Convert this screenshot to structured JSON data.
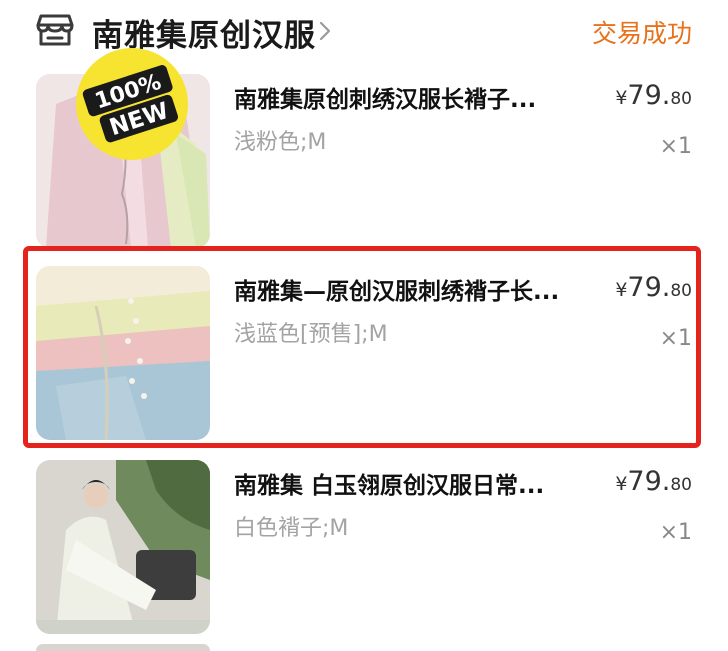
{
  "shop": {
    "name": "南雅集原创汉服",
    "status": "交易成功",
    "status_color": "#e8711c",
    "icon": "store-icon"
  },
  "items": [
    {
      "title": "南雅集原创刺绣汉服长褙子...",
      "spec": "浅粉色;M",
      "price_currency": "¥",
      "price_int": "79.",
      "price_dec": "80",
      "qty": "×1",
      "badge_line1": "100%",
      "badge_line2": "NEW"
    },
    {
      "title": "南雅集—原创汉服刺绣褙子长...",
      "spec": "浅蓝色[预售];M",
      "price_currency": "¥",
      "price_int": "79.",
      "price_dec": "80",
      "qty": "×1"
    },
    {
      "title": "南雅集  白玉翎原创汉服日常...",
      "spec": "白色褙子;M",
      "price_currency": "¥",
      "price_int": "79.",
      "price_dec": "80",
      "qty": "×1"
    }
  ],
  "highlight_color": "#e5231d"
}
